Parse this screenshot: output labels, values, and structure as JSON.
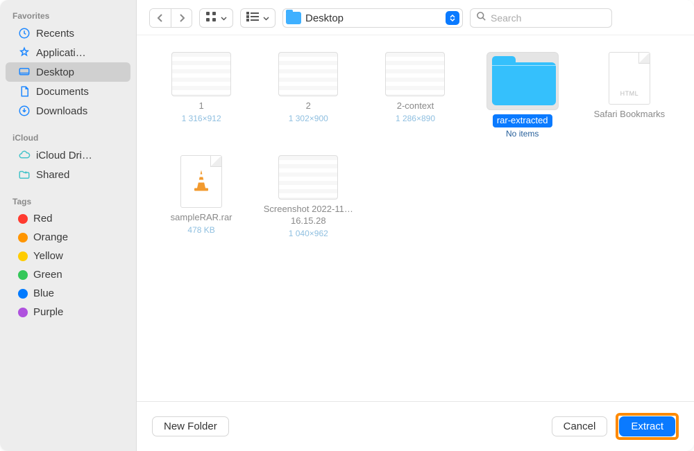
{
  "sidebar": {
    "sections": {
      "favorites": {
        "header": "Favorites",
        "items": [
          {
            "label": "Recents"
          },
          {
            "label": "Applicati…"
          },
          {
            "label": "Desktop"
          },
          {
            "label": "Documents"
          },
          {
            "label": "Downloads"
          }
        ]
      },
      "icloud": {
        "header": "iCloud",
        "items": [
          {
            "label": "iCloud Dri…"
          },
          {
            "label": "Shared"
          }
        ]
      },
      "tags": {
        "header": "Tags",
        "items": [
          {
            "label": "Red",
            "color": "#ff3b30"
          },
          {
            "label": "Orange",
            "color": "#ff9500"
          },
          {
            "label": "Yellow",
            "color": "#ffcc00"
          },
          {
            "label": "Green",
            "color": "#34c759"
          },
          {
            "label": "Blue",
            "color": "#007aff"
          },
          {
            "label": "Purple",
            "color": "#af52de"
          }
        ]
      }
    }
  },
  "toolbar": {
    "location": "Desktop",
    "search_placeholder": "Search"
  },
  "files": [
    {
      "name": "1",
      "sub": "1 316×912",
      "kind": "image"
    },
    {
      "name": "2",
      "sub": "1 302×900",
      "kind": "image"
    },
    {
      "name": "2-context",
      "sub": "1 286×890",
      "kind": "image"
    },
    {
      "name": "rar-extracted",
      "sub": "No items",
      "kind": "folder",
      "selected": true
    },
    {
      "name": "Safari Bookmarks",
      "sub": "",
      "kind": "html"
    },
    {
      "name": "sampleRAR.rar",
      "sub": "478 KB",
      "kind": "rar"
    },
    {
      "name": "Screenshot 2022-11…16.15.28",
      "sub": "1 040×962",
      "kind": "image"
    }
  ],
  "footer": {
    "new_folder": "New Folder",
    "cancel": "Cancel",
    "extract": "Extract"
  }
}
